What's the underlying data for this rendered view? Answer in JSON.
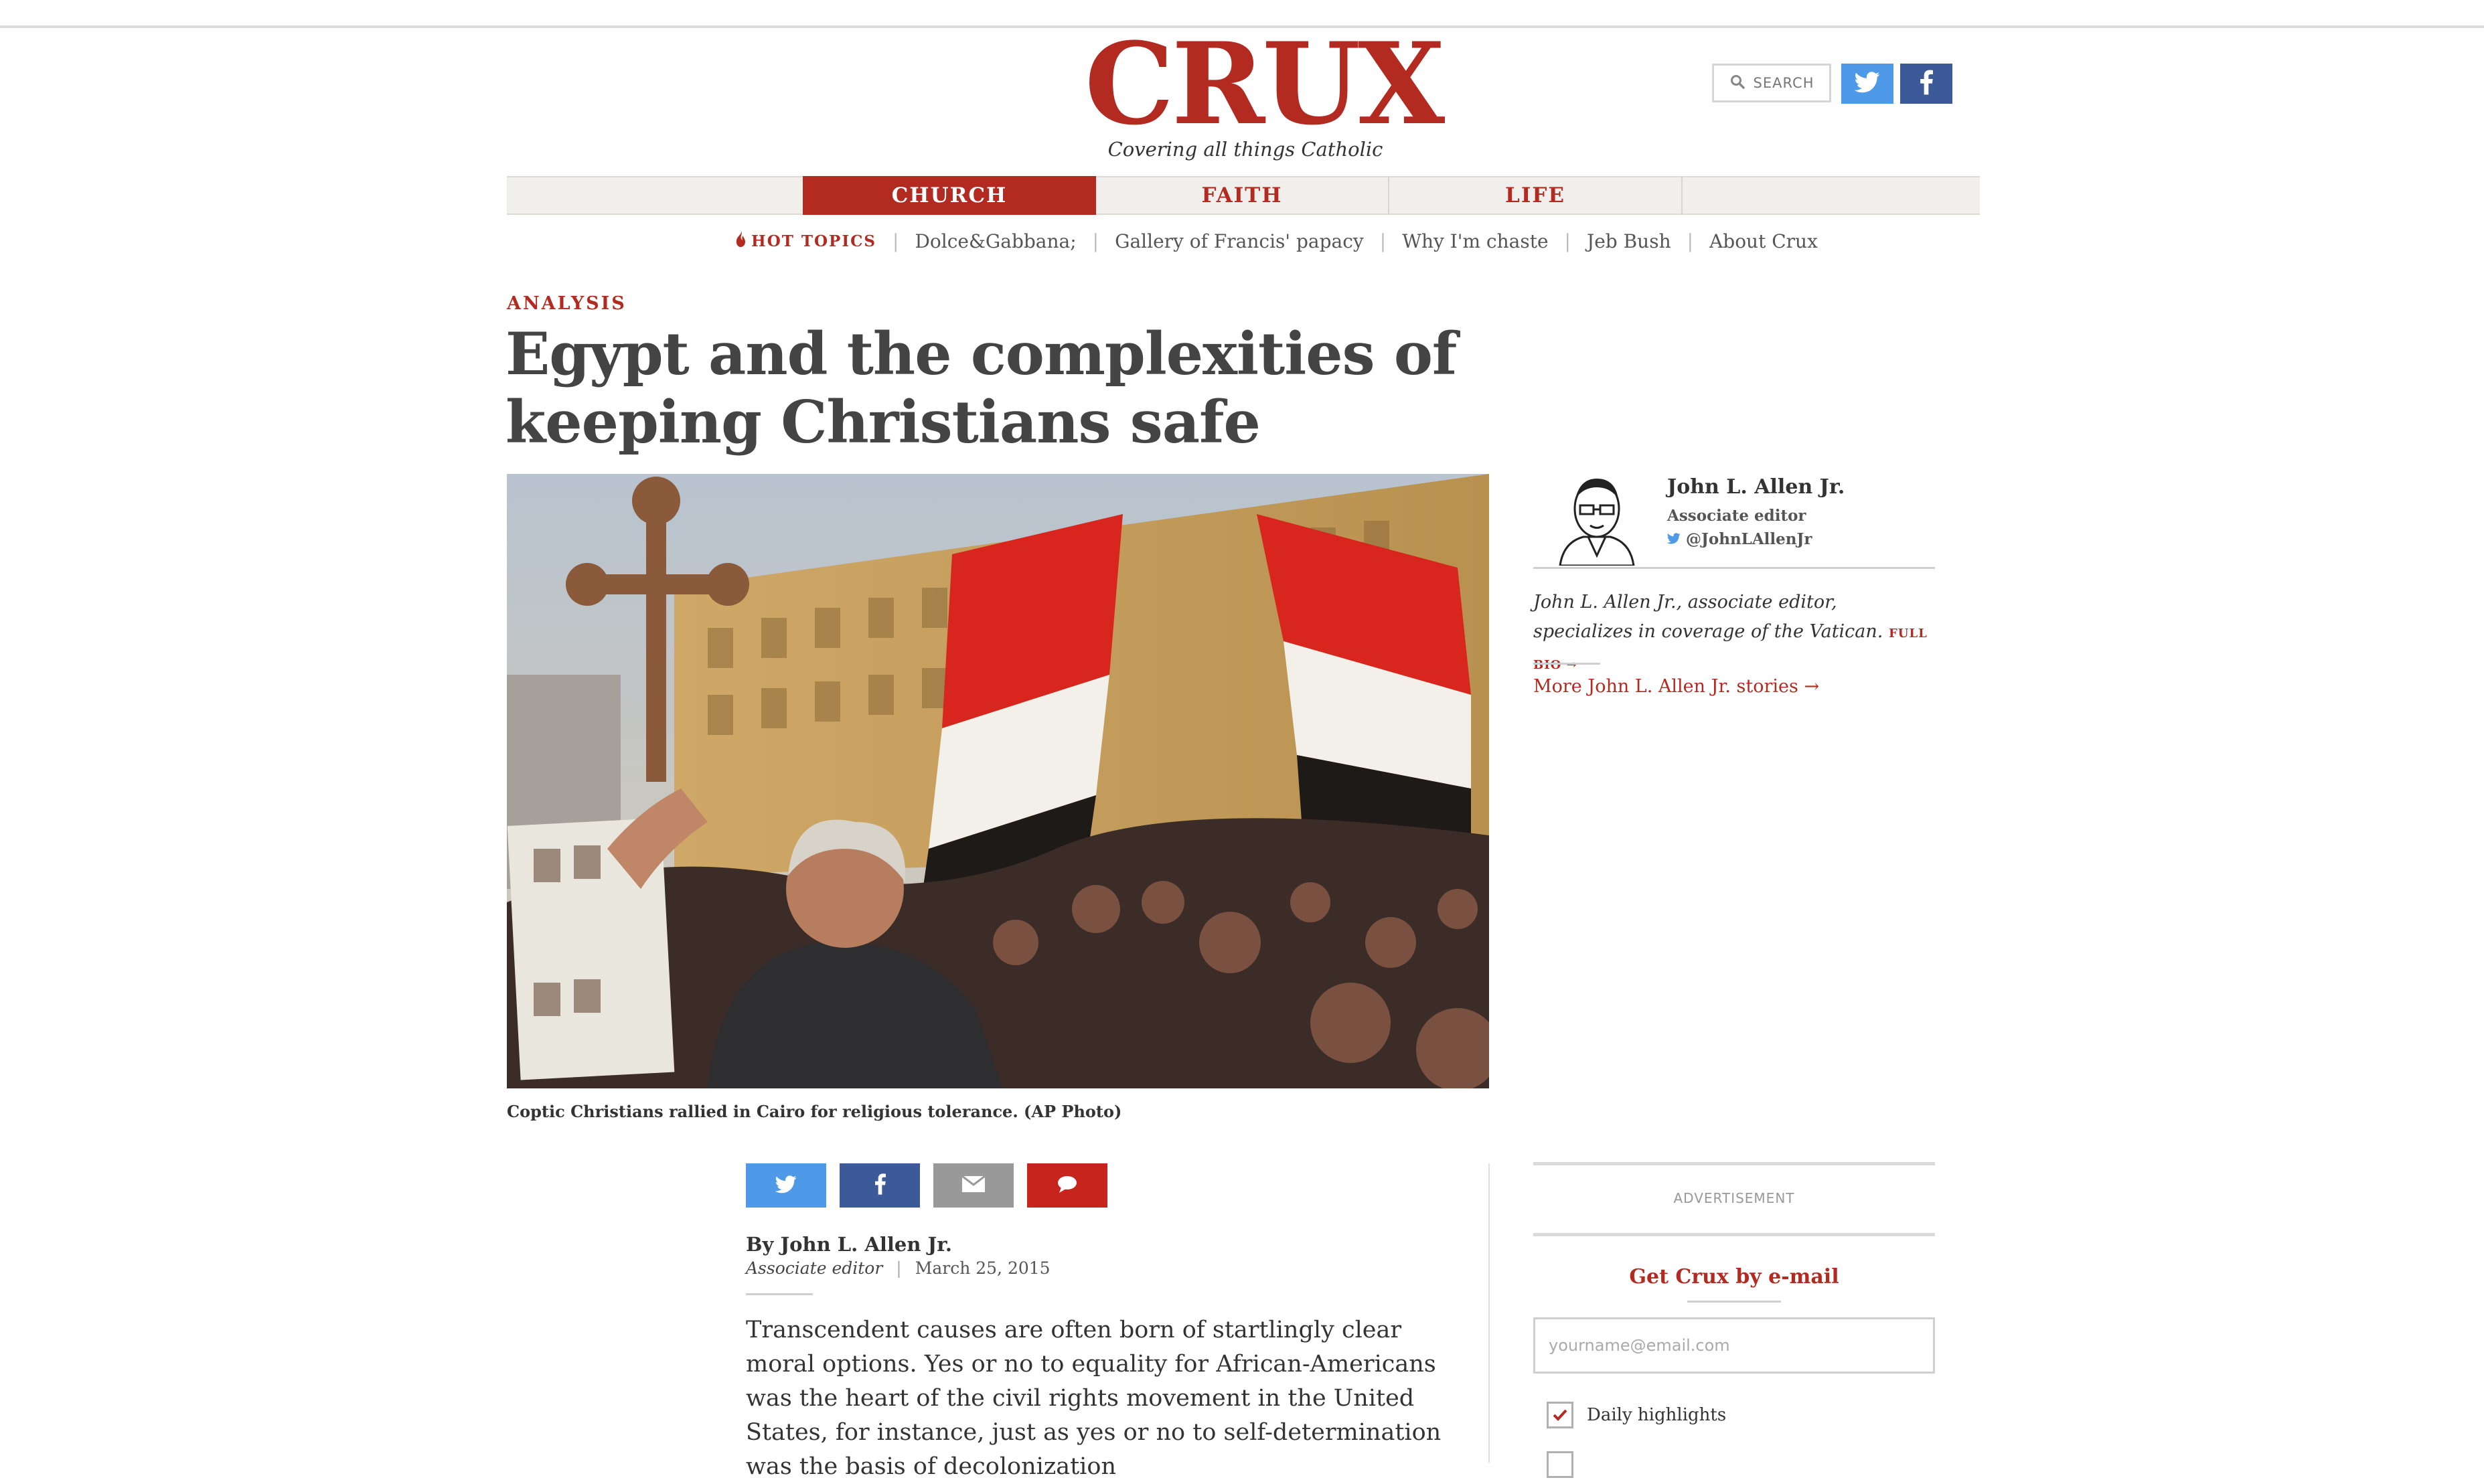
{
  "header": {
    "logo_text": "CRUX",
    "tagline": "Covering all things Catholic",
    "search_label": "SEARCH",
    "twitter_icon": "twitter-icon",
    "facebook_icon": "facebook-icon"
  },
  "nav": {
    "tabs": [
      {
        "label": "CHURCH",
        "active": true
      },
      {
        "label": "FAITH",
        "active": false
      },
      {
        "label": "LIFE",
        "active": false
      }
    ]
  },
  "hot_topics": {
    "label": "HOT TOPICS",
    "icon": "flame-icon",
    "links": [
      "Dolce&Gabbana;",
      "Gallery of Francis' papacy",
      "Why I'm chaste",
      "Jeb Bush",
      "About Crux"
    ]
  },
  "article": {
    "kicker": "ANALYSIS",
    "headline": "Egypt and the complexities of keeping Christians safe",
    "photo_caption": "Coptic Christians rallied in Cairo for religious tolerance. (AP Photo)",
    "byline": "By John L. Allen Jr.",
    "byline_role": "Associate editor",
    "date": "March 25, 2015",
    "body": "Transcendent causes are often born of startlingly clear moral options. Yes or no to equality for African-Americans was the heart of the civil rights movement in the United States, for instance, just as yes or no to self-determination was the basis of decolonization"
  },
  "share": {
    "icons": [
      "twitter-icon",
      "facebook-icon",
      "email-icon",
      "comment-icon"
    ]
  },
  "author": {
    "name": "John L. Allen Jr.",
    "role": "Associate editor",
    "twitter": "@JohnLAllenJr",
    "bio": "John L. Allen Jr., associate editor, specializes in coverage of the Vatican.",
    "full_bio_label": "FULL BIO",
    "more_link": "More John L. Allen Jr. stories"
  },
  "sidebar": {
    "ad_label": "ADVERTISEMENT",
    "email_title": "Get Crux by e-mail",
    "email_placeholder": "yourname@email.com",
    "options": [
      {
        "label": "Daily highlights",
        "checked": true
      }
    ]
  },
  "colors": {
    "brand_red": "#b32a21",
    "twitter_blue": "#4f9ae8",
    "facebook_blue": "#3d5a98"
  }
}
